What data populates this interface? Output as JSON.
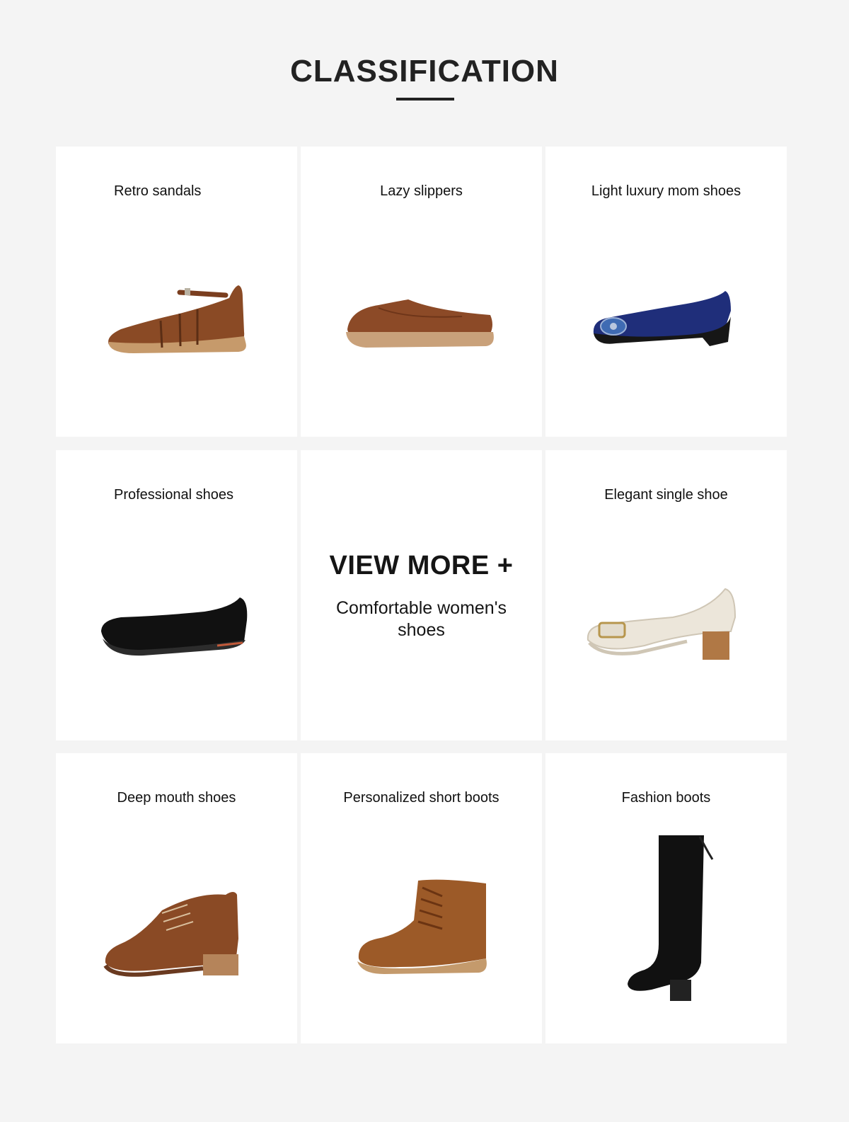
{
  "header": {
    "title": "CLASSIFICATION"
  },
  "categories": [
    {
      "label": "Retro sandals",
      "icon": "retro-sandal-image"
    },
    {
      "label": "Lazy slippers",
      "icon": "lazy-slipper-image"
    },
    {
      "label": "Light luxury mom shoes",
      "icon": "blue-wedge-flat-image"
    },
    {
      "label": "Professional shoes",
      "icon": "black-flat-image"
    },
    {
      "label": "Elegant single shoe",
      "icon": "cream-pump-image"
    },
    {
      "label": "Deep mouth shoes",
      "icon": "brown-oxford-heel-image"
    },
    {
      "label": "Personalized short boots",
      "icon": "tan-ankle-boot-image"
    },
    {
      "label": "Fashion boots",
      "icon": "black-knee-boot-image"
    }
  ],
  "view_more": {
    "title": "VIEW MORE +",
    "subtitle": "Comfortable women's shoes"
  },
  "colors": {
    "page_background": "#f4f4f4",
    "card_background": "#ffffff",
    "text": "#1a1a1a",
    "brown_leather": "#8a4a25",
    "navy_leather": "#1f2e7a",
    "cream_leather": "#ece6da",
    "black_leather": "#111111"
  }
}
